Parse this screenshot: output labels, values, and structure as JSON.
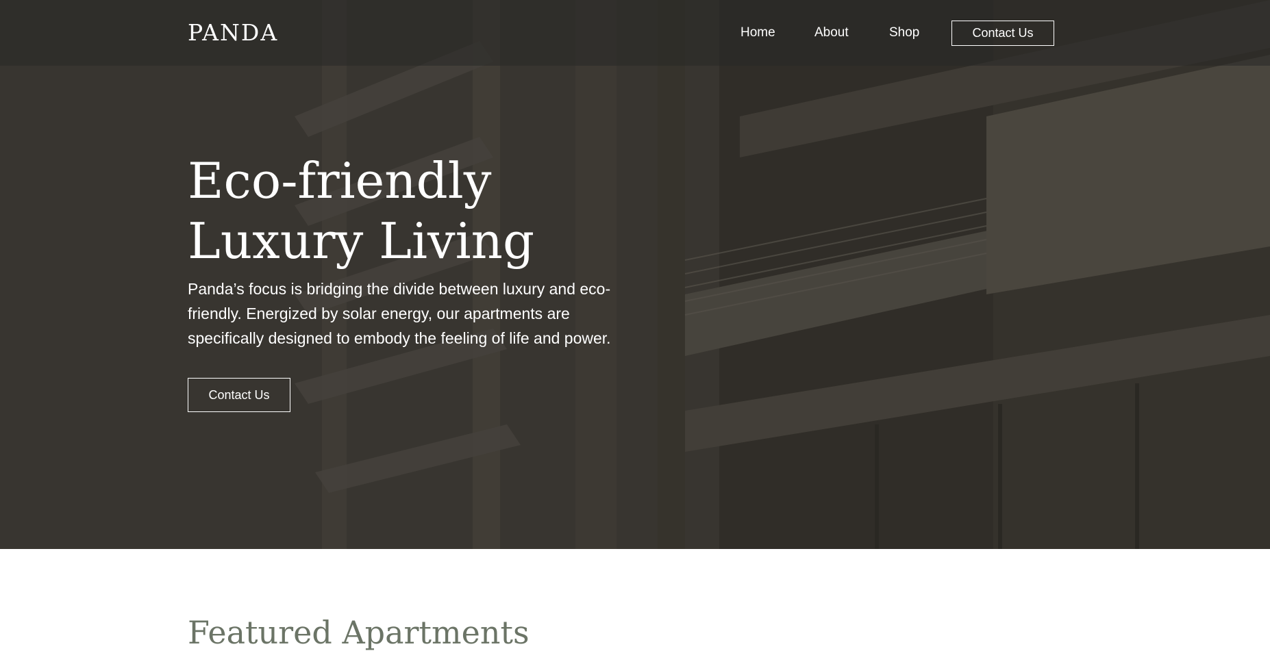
{
  "brand": {
    "logo_text": "PANDA"
  },
  "nav": {
    "items": [
      {
        "label": "Home"
      },
      {
        "label": "About"
      },
      {
        "label": "Shop"
      }
    ],
    "contact_label": "Contact Us"
  },
  "hero": {
    "title_line1": "Eco-friendly",
    "title_line2": "Luxury Living",
    "description": "Panda’s focus is bridging the divide between luxury and eco-friendly. Energized by solar energy, our apartments are specifically designed to embody the feeling of life and power.",
    "cta_label": "Contact Us",
    "background_image": "building-facade-with-balconies"
  },
  "featured": {
    "title": "Featured Apartments"
  },
  "colors": {
    "hero_overlay": "#3a3731",
    "text_on_dark": "#ffffff",
    "featured_heading": "#6b7466",
    "page_background": "#ffffff"
  }
}
